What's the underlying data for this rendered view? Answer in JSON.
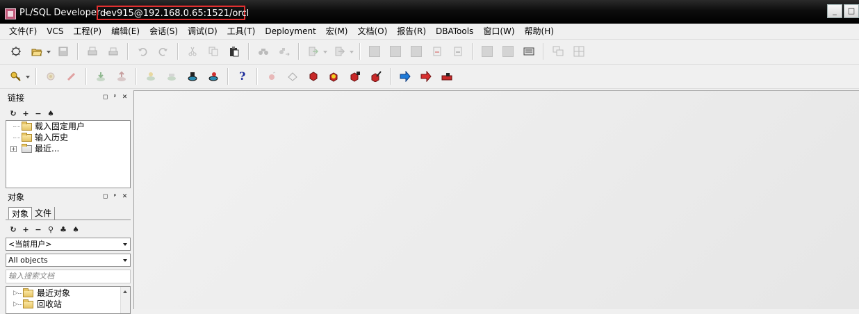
{
  "window": {
    "app_name": "PL/SQL Developer",
    "separator": "-",
    "connection": "dev915@192.168.0.65:1521/orcl",
    "controls": {
      "minimize": "_",
      "maximize": "□"
    }
  },
  "menu": [
    "文件(F)",
    "VCS",
    "工程(P)",
    "编辑(E)",
    "会话(S)",
    "调试(D)",
    "工具(T)",
    "Deployment",
    "宏(M)",
    "文档(O)",
    "报告(R)",
    "DBATools",
    "窗口(W)",
    "帮助(H)"
  ],
  "toolbar_icons_row1": [
    "new-icon",
    "open-icon",
    "save-icon",
    "print-icon",
    "print-preview-icon",
    "undo-icon",
    "redo-icon",
    "cut-icon",
    "copy-icon",
    "paste-icon",
    "find-icon",
    "replace-icon",
    "execute-icon",
    "step-icon",
    "comment-icon",
    "indent-icon",
    "unindent-icon",
    "uppercase-icon",
    "lowercase-icon",
    "explain-icon",
    "describe-icon",
    "query-builder-icon",
    "tile-windows-icon",
    "cascade-windows-icon"
  ],
  "toolbar_icons_row2": [
    "logon-key-icon",
    "break-icon",
    "clear-icon",
    "export-icon",
    "import-icon",
    "compare-icon",
    "compile-icon",
    "run-test-icon",
    "test-script-icon",
    "help-icon",
    "bookmark-icon",
    "eraser-icon",
    "object-red-icon",
    "object-yellow-icon",
    "object-lock-icon",
    "object-edit-icon",
    "forward-arrow-icon",
    "back-arrow-icon",
    "logout-icon"
  ],
  "help_glyph": "?",
  "colors": {
    "title_highlight": "#e03030",
    "arrow_blue": "#1e7ad8",
    "arrow_red": "#d83030"
  },
  "connections_panel": {
    "title": "链接",
    "controls": [
      "◻",
      "ᵖ",
      "✕"
    ],
    "toolbar": [
      "↻",
      "+",
      "−",
      "♠"
    ],
    "items": [
      "载入固定用户",
      "输入历史",
      "最近..."
    ]
  },
  "objects_panel": {
    "title": "对象",
    "controls": [
      "◻",
      "ᵖ",
      "✕"
    ],
    "tabs": [
      "对象",
      "文件"
    ],
    "toolbar": [
      "↻",
      "+",
      "−",
      "⚲",
      "♣",
      "♠"
    ],
    "user_combo": "<当前用户>",
    "filter_combo": "All objects",
    "search_placeholder": "输入搜索文档",
    "items": [
      "最近对象",
      "回收站"
    ]
  }
}
